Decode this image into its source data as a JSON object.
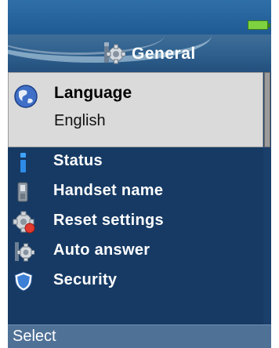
{
  "header": {
    "title": "General",
    "title_icon": "gear-icon",
    "battery_icon": "battery-full-icon"
  },
  "menu": {
    "selected": {
      "label": "Language",
      "value": "English",
      "icon": "globe-icon"
    },
    "items": [
      {
        "label": "Status",
        "icon": "info-icon"
      },
      {
        "label": "Handset name",
        "icon": "handset-icon"
      },
      {
        "label": "Reset settings",
        "icon": "reset-gear-icon"
      },
      {
        "label": "Auto answer",
        "icon": "gear-icon"
      },
      {
        "label": "Security",
        "icon": "shield-icon"
      }
    ]
  },
  "softkeys": {
    "left": "Select"
  },
  "colors": {
    "background": "#163a64",
    "title_bar": "#2e5f8d",
    "selected_row": "#dadada",
    "softkey_bar": "#4f7196",
    "battery": "#7ed23f"
  }
}
